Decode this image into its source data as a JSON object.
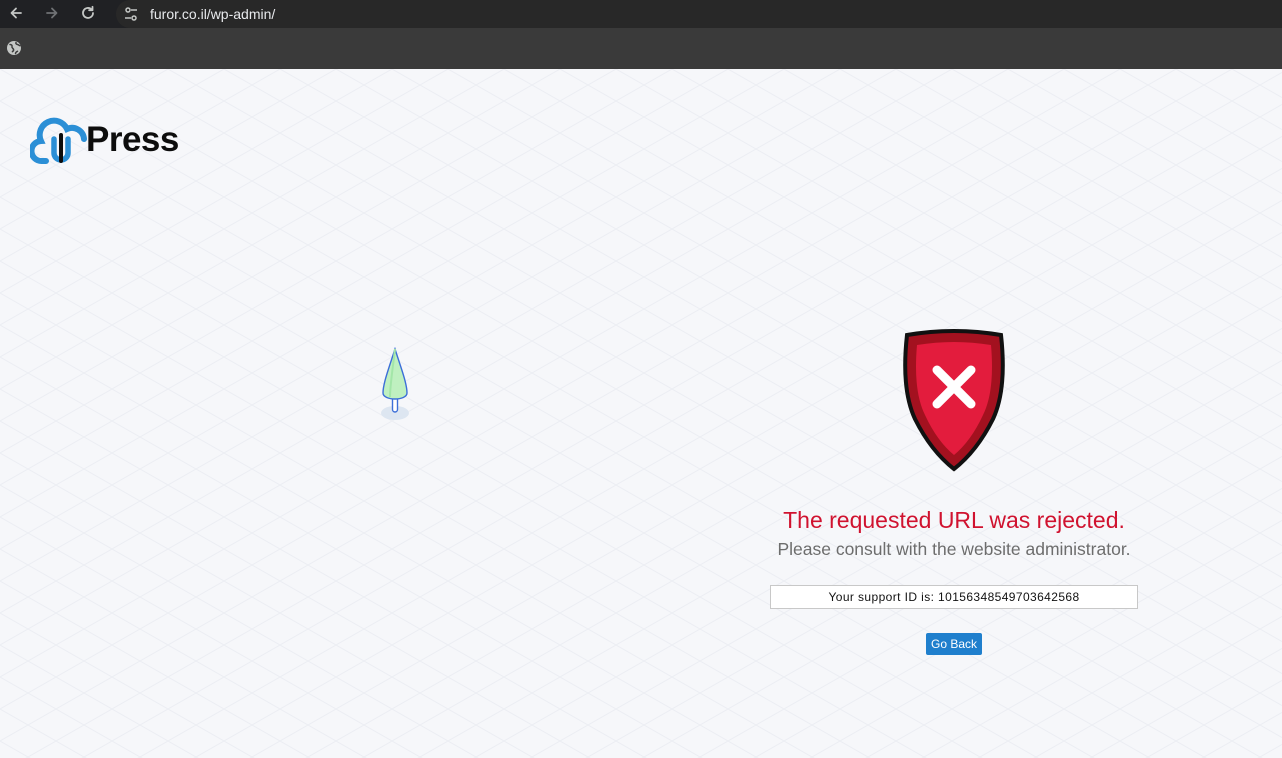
{
  "browser": {
    "url": "furor.co.il/wp-admin/",
    "icons": [
      "back-arrow-icon",
      "forward-arrow-icon",
      "reload-icon",
      "site-settings-icon",
      "globe-icon"
    ]
  },
  "logo": {
    "text": "Press"
  },
  "message": {
    "title": "The requested URL was rejected.",
    "subtitle": "Please consult with the website administrator.",
    "support_id_text": "Your support ID is: 10156348549703642568",
    "go_back_label": "Go Back"
  },
  "colors": {
    "title_red": "#d0122f",
    "button_blue": "#1f7fcd",
    "shield_red": "#e31c3d",
    "logo_blue": "#2b8fd6"
  }
}
